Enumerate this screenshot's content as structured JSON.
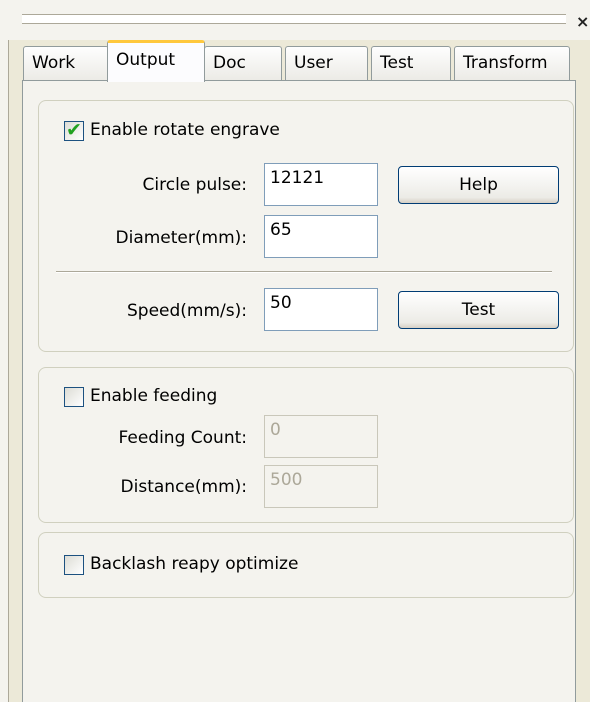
{
  "window": {
    "close_glyph": "×"
  },
  "tabs": [
    {
      "label": "Work"
    },
    {
      "label": "Output",
      "active": true
    },
    {
      "label": "Doc"
    },
    {
      "label": "User"
    },
    {
      "label": "Test"
    },
    {
      "label": "Transform"
    }
  ],
  "rotate": {
    "enable_label": "Enable rotate engrave",
    "enabled": true,
    "circle_pulse_label": "Circle pulse:",
    "circle_pulse_value": "12121",
    "diameter_label": "Diameter(mm):",
    "diameter_value": "65",
    "speed_label": "Speed(mm/s):",
    "speed_value": "50",
    "help_button": "Help",
    "test_button": "Test"
  },
  "feeding": {
    "enable_label": "Enable feeding",
    "enabled": false,
    "count_label": "Feeding Count:",
    "count_value": "0",
    "distance_label": "Distance(mm):",
    "distance_value": "500"
  },
  "backlash": {
    "label": "Backlash reapy optimize",
    "enabled": false
  },
  "icons": {
    "check": "check-icon",
    "close": "close-icon"
  },
  "colors": {
    "tab_highlight": "#ffc83c",
    "check_green": "#21a121",
    "panel_bg": "#f4f3ee"
  }
}
